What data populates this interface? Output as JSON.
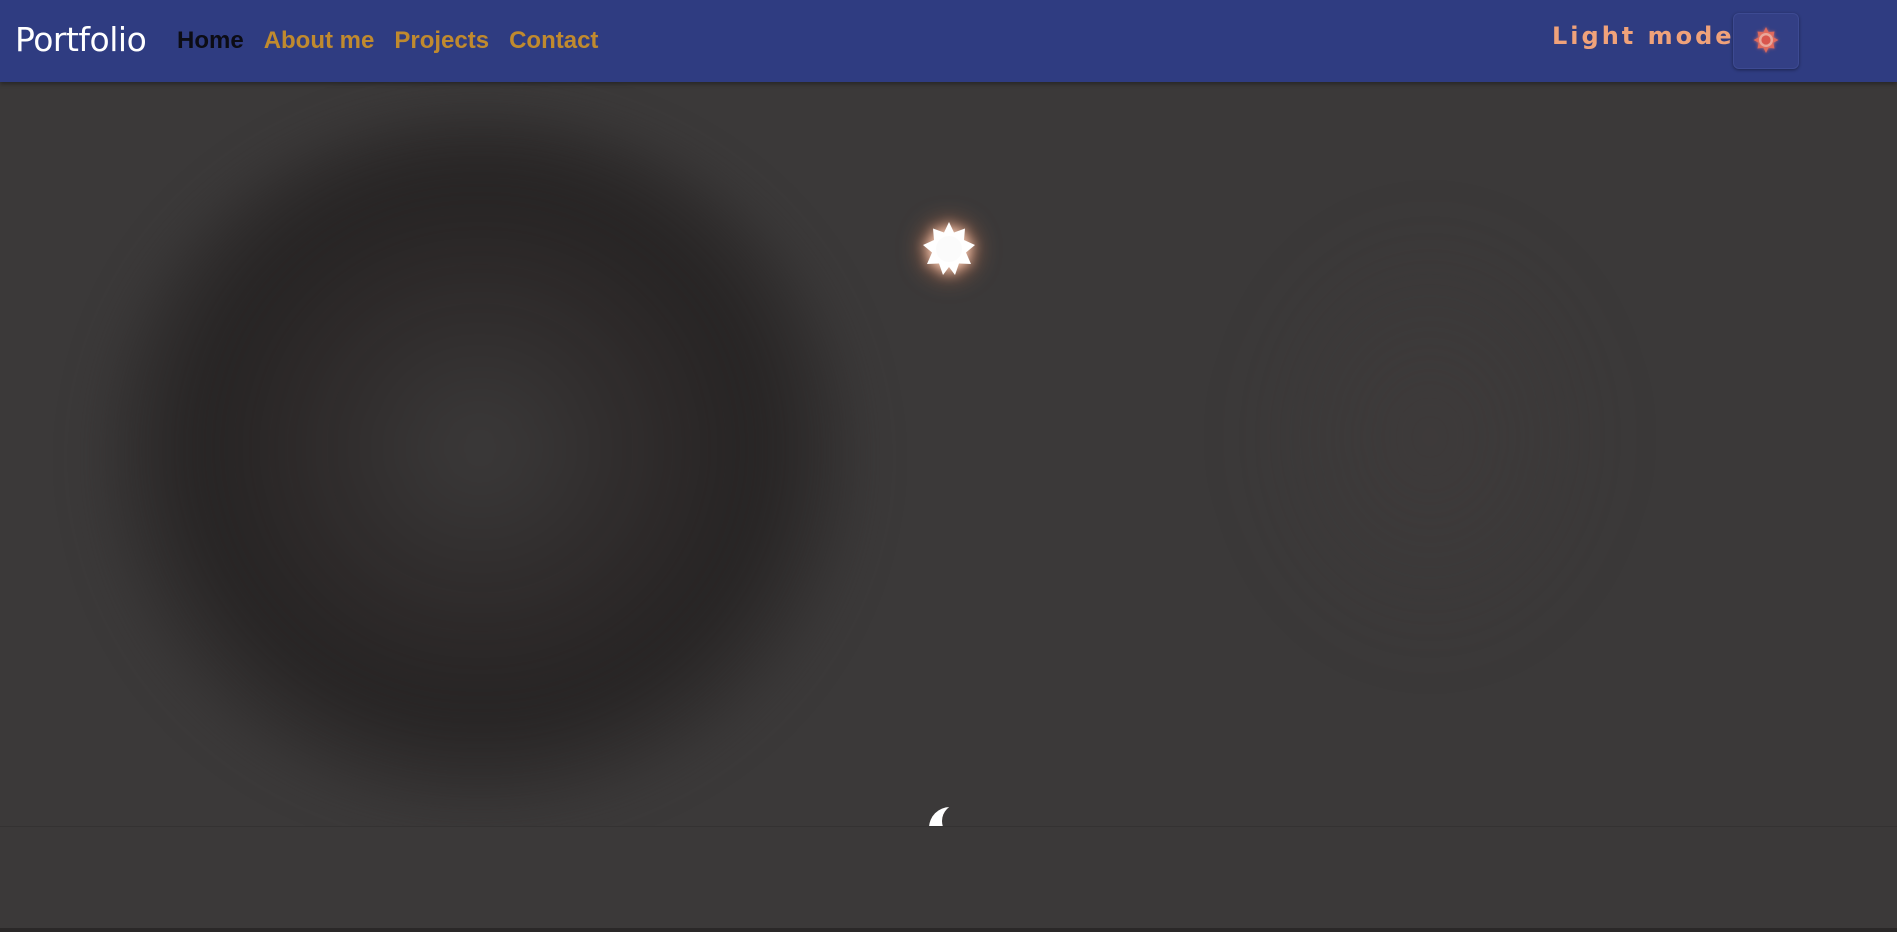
{
  "navbar": {
    "brand": "Portfolio",
    "links": [
      {
        "label": "Home",
        "active": true
      },
      {
        "label": "About me",
        "active": false
      },
      {
        "label": "Projects",
        "active": false
      },
      {
        "label": "Contact",
        "active": false
      }
    ],
    "mode_label": "Light mode",
    "toggle_icon": "sun-icon"
  },
  "hero": {
    "sun_icon": "sun-icon",
    "moon_icon": "moon-icon"
  },
  "colors": {
    "navbar_bg": "#2f3c81",
    "page_bg": "#3b3939",
    "link": "#c08a2e",
    "link_active": "#0c0c14",
    "mode_label": "#f0a27a"
  }
}
